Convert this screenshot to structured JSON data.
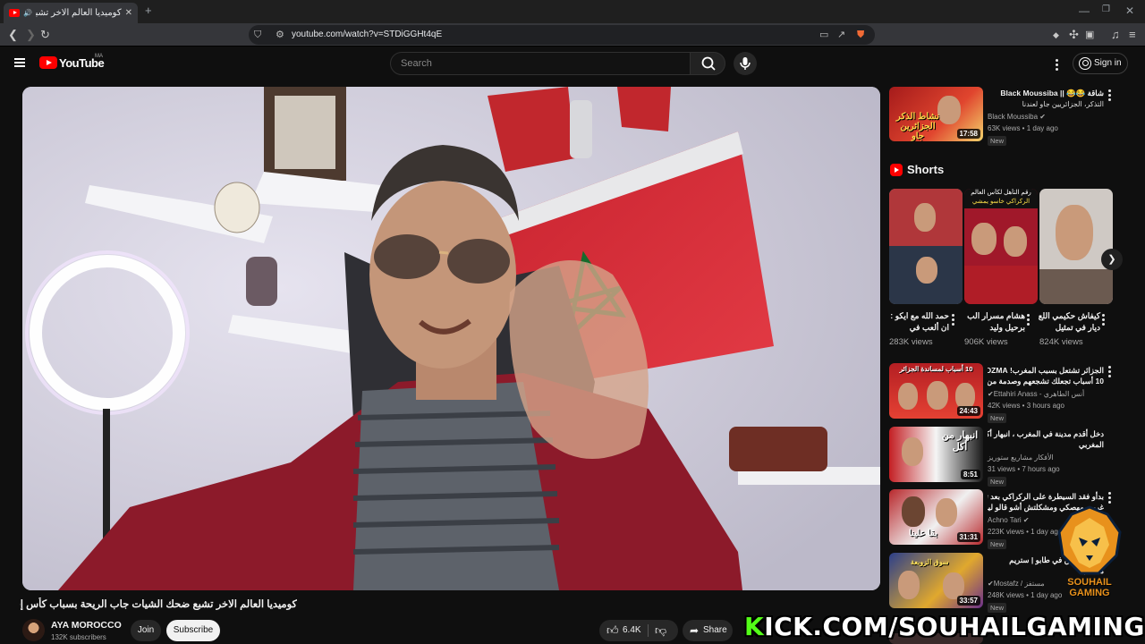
{
  "browser": {
    "tab_title": "كوميديا العالم الاخر تشبع ضحك",
    "url": "youtube.com/watch?v=STDiGGHt4qE"
  },
  "header": {
    "logo_text": "YouTube",
    "country_code": "MA",
    "search_placeholder": "Search",
    "sign_in_label": "Sign in"
  },
  "video": {
    "title": "كوميديا العالم الاخر تشبع ضحك الشيات جاب الريحة بسباب كأس إفريقيا 🤣",
    "channel_name": "AYA MOROCCO",
    "subscribers": "132K subscribers",
    "join_label": "Join",
    "subscribe_label": "Subscribe",
    "like_count": "6.4K",
    "share_label": "Share"
  },
  "sidebar": {
    "top_video": {
      "title": "شاقة 😂😂 || Black Moussiba",
      "title_line2": "التذكر، الجزائريين جاو لعندنا",
      "channel": "Black Moussiba",
      "meta": "63K views • 1 day ago",
      "duration": "17:58",
      "badge": "New",
      "thumb_text": "نشاط الذكر الجزائرين جاو"
    },
    "shorts_heading": "Shorts",
    "shorts": [
      {
        "title": "حمد الله مع ايكو : ان ألعب في",
        "views": "283K views"
      },
      {
        "title": "هشام مسرار الب برحيل وليد",
        "views": "906K views"
      },
      {
        "title": "كيفاش حكيمي اللع ديار في تمثيل",
        "views": "824K views"
      }
    ],
    "short2_banner": "رقم التأهل لكأس العالم",
    "short2_banner_sub": "الركراكي خاسو يمشي",
    "videos": [
      {
        "title": "الجزائر تشتعل بسبب المغرب! DZMA شاهد",
        "title2": "10 أسباب تجعلك تشجعهم وصدمة من اسلهم",
        "channel": "Ettahiri Anass - أنس الطاهري",
        "meta": "42K views • 3 hours ago",
        "duration": "24:43",
        "badge": "New",
        "thumb_text": "10 أسباب لمساندة الجزائر"
      },
      {
        "title": "دخل أقدم مدينة في المغرب ، انبهار أكل",
        "title2": "المغربي",
        "channel": "الأفكار مشاريع ستوريز",
        "meta": "31 views • 7 hours ago",
        "duration": "8:51",
        "badge": "New",
        "thumb_text": "انبهار من أكل"
      },
      {
        "title": "بدأو فقد السيطرة على الركراكي بعد تعادل",
        "title2": "غريب مهصكي ومشكلتش أشو قالو ليه",
        "channel": "Achno Tari",
        "meta": "223K views • 1 day ago",
        "duration": "31:31",
        "badge": "New",
        "thumb_text": "بقا علينا"
      },
      {
        "title": "حملت كسين في طابو | ستريم",
        "title2": "مضايب",
        "channel": "Mostafz / مستفز",
        "meta": "248K views • 1 day ago",
        "duration": "33:57",
        "badge": "New",
        "thumb_text": "سوق الزوبعة"
      }
    ]
  },
  "overlay": {
    "kick_k": "K",
    "kick_text": "ICK.COM/SOUHAILGAMING",
    "logo_line1": "SOUHAIL",
    "logo_line2": "GAMING"
  }
}
